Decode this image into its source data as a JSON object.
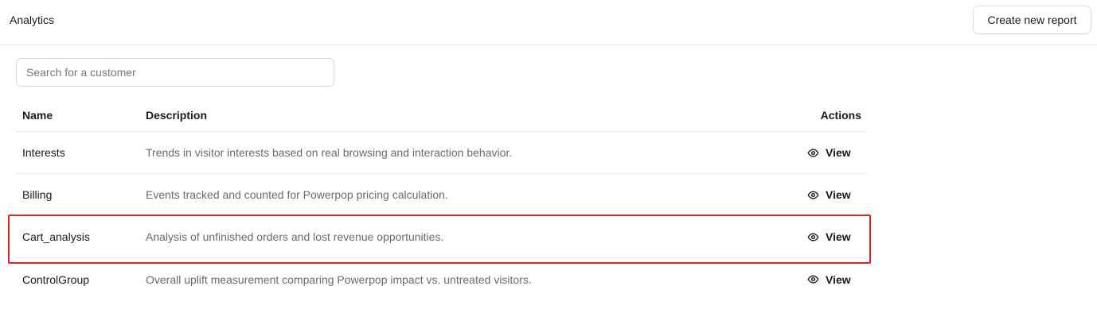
{
  "header": {
    "title": "Analytics",
    "create_label": "Create new report"
  },
  "search": {
    "placeholder": "Search for a customer",
    "value": ""
  },
  "table": {
    "columns": {
      "name": "Name",
      "description": "Description",
      "actions": "Actions"
    },
    "rows": [
      {
        "name": "Interests",
        "description": "Trends in visitor interests based on real browsing and interaction behavior.",
        "action_label": "View",
        "action_icon": "eye-icon"
      },
      {
        "name": "Billing",
        "description": "Events tracked and counted for Powerpop pricing calculation.",
        "action_label": "View",
        "action_icon": "eye-icon"
      },
      {
        "name": "Cart_analysis",
        "description": "Analysis of unfinished orders and lost revenue opportunities.",
        "action_label": "View",
        "action_icon": "eye-icon"
      },
      {
        "name": "ControlGroup",
        "description": "Overall uplift measurement comparing Powerpop impact vs. untreated visitors.",
        "action_label": "View",
        "action_icon": "eye-icon"
      }
    ]
  },
  "colors": {
    "highlight": "#e02424",
    "border": "#e6e6e6",
    "muted_text": "#6b6b6b"
  }
}
